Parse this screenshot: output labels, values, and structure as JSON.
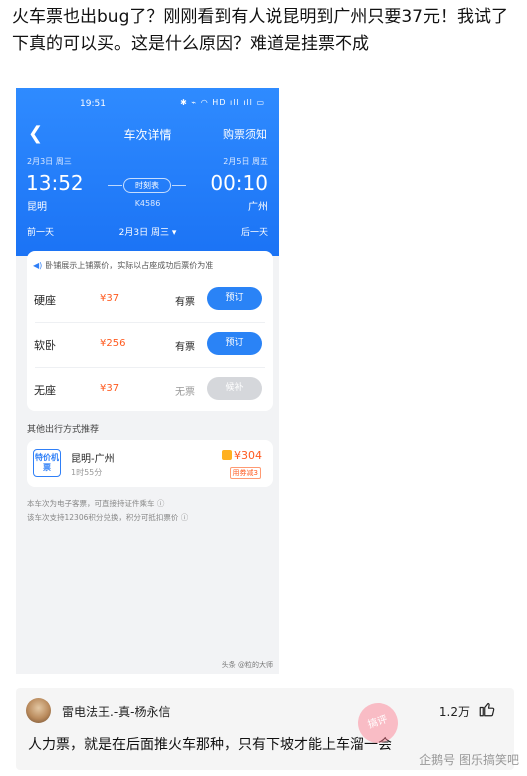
{
  "post": {
    "text": "火车票也出bug了？刚刚看到有人说昆明到广州只要37元！我试了下真的可以买。这是什么原因？难道是挂票不成"
  },
  "phone": {
    "status_time": "19:51",
    "status_icons": "✱ ⌁ ◠ HD ıll ıll ▭",
    "title": "车次详情",
    "notice_link": "购票须知",
    "departure": {
      "date": "2月3日 周三",
      "time": "13:52",
      "station": "昆明"
    },
    "arrival": {
      "date": "2月5日 周五",
      "time": "00:10",
      "station": "广州"
    },
    "timetable_label": "时刻表",
    "train_no": "K4586",
    "prev_day": "前一天",
    "current_date": "2月3日 周三 ▾",
    "next_day": "后一天",
    "price_notice": "卧铺展示上铺票价，实际以占座成功后票价为准",
    "seats": [
      {
        "type": "硬座",
        "price": "¥37",
        "availability": "有票",
        "button": "预订"
      },
      {
        "type": "软卧",
        "price": "¥256",
        "availability": "有票",
        "button": "预订"
      },
      {
        "type": "无座",
        "price": "¥37",
        "availability": "无票",
        "button": "候补"
      }
    ],
    "alt_title": "其他出行方式推荐",
    "alt_option": {
      "badge": "特价机票",
      "route": "昆明-广州",
      "duration": "1时55分",
      "price": "¥304",
      "discount": "用券减3"
    },
    "footnotes": [
      "本车次为电子客票，可直接持证件乘车 ⓘ",
      "该车次支持12306积分兑换，积分可抵扣票价 ⓘ"
    ],
    "watermark": "头条 @粒的大师"
  },
  "comment": {
    "user": "雷电法王.-真-杨永信",
    "likes": "1.2万",
    "text": "人力票，就是在后面推火车那种，只有下坡才能上车溜一会"
  },
  "watermark": {
    "stamp": "搞评",
    "text": "企鹅号 图乐搞笑吧"
  },
  "colors": {
    "header_blue": "#1b73f5",
    "button_blue": "#2a83f6",
    "price_orange": "#ff5a1f",
    "disabled_gray": "#d5d7db"
  },
  "icons": [
    "back-arrow-icon",
    "speaker-icon",
    "dropdown-caret-icon",
    "thumb-up-icon",
    "info-icon"
  ]
}
